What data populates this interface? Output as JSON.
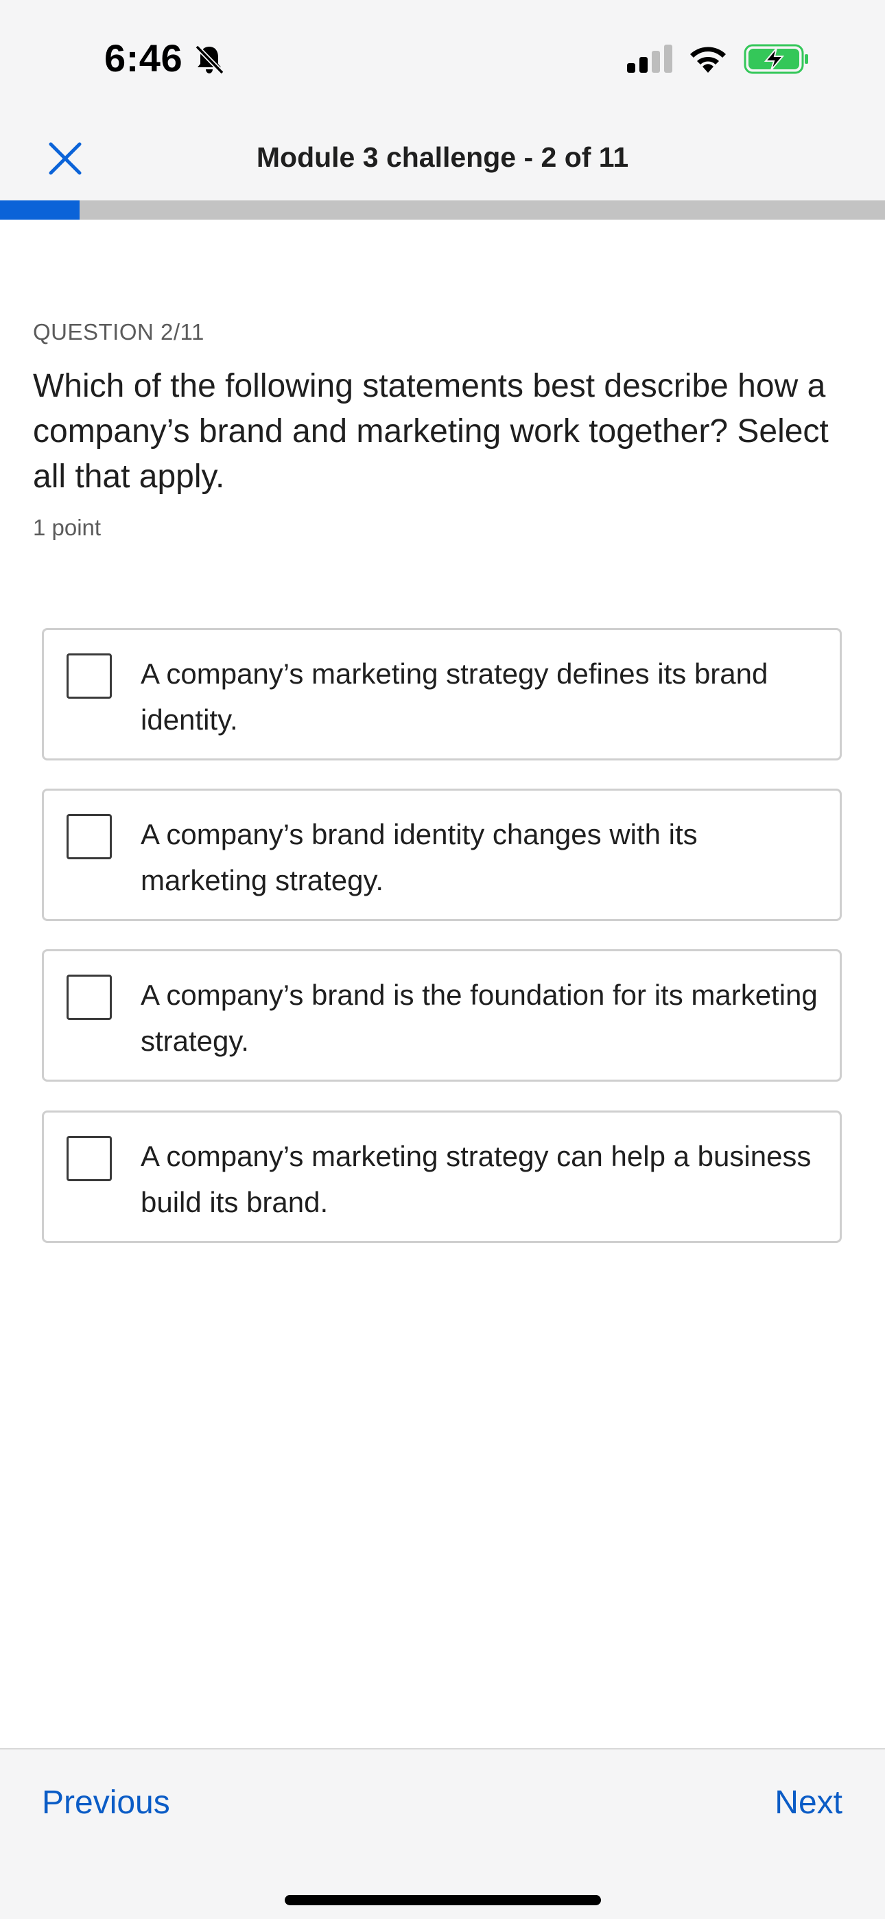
{
  "status_bar": {
    "time": "6:46",
    "icons": [
      "bell-slash-icon",
      "signal-icon",
      "wifi-icon",
      "battery-charging-icon"
    ],
    "battery_color": "#34c759"
  },
  "header": {
    "title": "Module 3 challenge - 2 of 11",
    "close_icon": "close-icon",
    "accent_color": "#0b63d8"
  },
  "progress": {
    "current": 2,
    "total": 11,
    "fraction": 0.09
  },
  "question": {
    "label": "QUESTION 2/11",
    "text": "Which of the following statements best describe how a company’s brand and marketing work together? Select all that apply.",
    "points": "1 point"
  },
  "options": [
    {
      "label": "A company’s marketing strategy defines its brand identity.",
      "checked": false
    },
    {
      "label": "A company’s brand identity changes with its marketing strategy.",
      "checked": false
    },
    {
      "label": "A company’s brand is the foundation for its marketing strategy.",
      "checked": false
    },
    {
      "label": "A company’s marketing strategy can help a business build its brand.",
      "checked": false
    }
  ],
  "footer": {
    "previous_label": "Previous",
    "next_label": "Next"
  }
}
